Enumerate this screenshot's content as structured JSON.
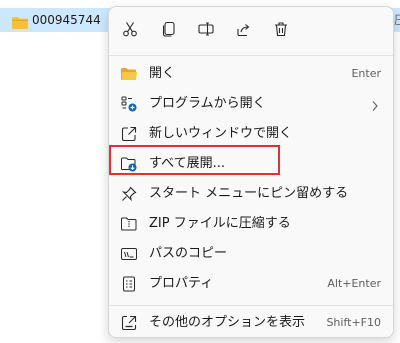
{
  "file_row": {
    "name": "000945744",
    "trailing_text": "圧"
  },
  "toolbar": {
    "icons": [
      "cut-icon",
      "copy-icon",
      "rename-icon",
      "share-icon",
      "delete-icon"
    ]
  },
  "menu": {
    "items": [
      {
        "label": "開く",
        "shortcut": "Enter",
        "icon": "folder-open-icon"
      },
      {
        "label": "プログラムから開く",
        "shortcut": "",
        "icon": "open-with-icon"
      },
      {
        "label": "新しいウィンドウで開く",
        "shortcut": "",
        "icon": "new-window-icon"
      },
      {
        "label": "すべて展開...",
        "shortcut": "",
        "icon": "extract-all-icon"
      },
      {
        "label": "スタート メニューにピン留めする",
        "shortcut": "",
        "icon": "pin-icon"
      },
      {
        "label": "ZIP ファイルに圧縮する",
        "shortcut": "",
        "icon": "zip-icon"
      },
      {
        "label": "パスのコピー",
        "shortcut": "",
        "icon": "copy-path-icon"
      },
      {
        "label": "プロパティ",
        "shortcut": "Alt+Enter",
        "icon": "properties-icon"
      },
      {
        "label": "その他のオプションを表示",
        "shortcut": "Shift+F10",
        "icon": "more-options-icon"
      }
    ]
  },
  "colors": {
    "accent": "#0067c0",
    "selection": "#cce8ff",
    "highlight_box": "#e8312d",
    "folder_yellow": "#f3c23c"
  }
}
